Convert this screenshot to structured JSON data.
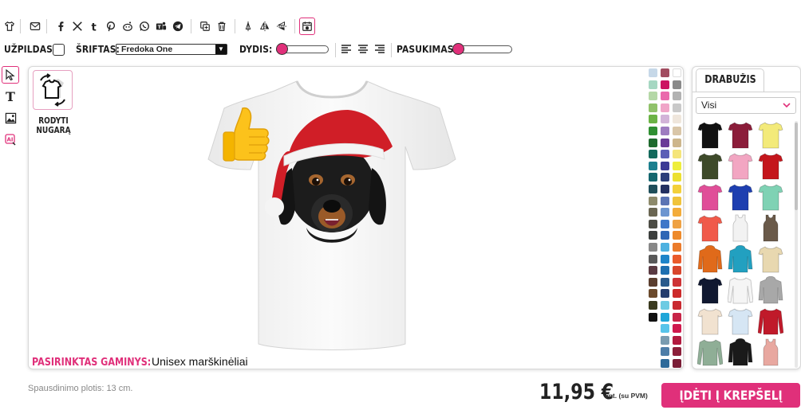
{
  "toolbar_text": {
    "fill_label": "UŽPILDAS:",
    "font_label": "ŠRIFTAS:",
    "font_value": "Fredoka One",
    "size_label": "DYDIS:",
    "size_value": 0,
    "rotation_label": "PASUKIMAS:",
    "rotation_value": 0
  },
  "canvas": {
    "show_back_label": "RODYTI NUGARĄ",
    "selected_product_label": "PASIRINKTAS GAMINYS:",
    "selected_product_value": "Unisex marškinėliai"
  },
  "palette": [
    "#c6d8e8",
    "#a14c60",
    "#ffffff",
    "#a6d7c2",
    "#cc1361",
    "#8a8a8a",
    "#b5d8a7",
    "#ea6aac",
    "#b2b2b2",
    "#90c26a",
    "#f0a5c8",
    "#c9c9c9",
    "#6bb345",
    "#d2b3d8",
    "#efe6dc",
    "#2f8f32",
    "#9e7cc0",
    "#d9c6a8",
    "#1e6a2e",
    "#6a3b97",
    "#cdb68c",
    "#146a5c",
    "#5b5fb6",
    "#f5e57a",
    "#1b7f8e",
    "#3b3a95",
    "#eeee3c",
    "#14666e",
    "#2c3e7a",
    "#ece030",
    "#1f4e5a",
    "#243061",
    "#f3d03a",
    "#8d8a6b",
    "#5b74b4",
    "#f0c33b",
    "#6a6652",
    "#6c95d0",
    "#f3ac3a",
    "#4d4d45",
    "#3f77c8",
    "#efa244",
    "#3c3f3d",
    "#2f67b5",
    "#ee8a2a",
    "#888888",
    "#4db1e0",
    "#eb7b2b",
    "#595959",
    "#1d84c9",
    "#ea5a2a",
    "#5a3a42",
    "#1d6fb0",
    "#d8452c",
    "#5b3e2e",
    "#295a8c",
    "#ce3336",
    "#6b4a2c",
    "#253d6e",
    "#cc2a2a",
    "#3a3a1e",
    "#6ccbe3",
    "#c92930",
    "#111111",
    "#1fa6d8",
    "#c82548",
    null,
    "#57c4ea",
    "#d0194d",
    null,
    "#7a9cb0",
    "#b21a3f",
    null,
    "#4e7ea8",
    "#8c1f3a",
    null,
    "#2e6a9a",
    "#7a1d36",
    null,
    "#6aa4c8",
    "#6a1c38",
    null,
    "#aee1f5",
    "#561a35"
  ],
  "garments_panel": {
    "tab_label": "DRABUŽIS",
    "filter_value": "Visi",
    "items": [
      {
        "name": "black-tshirt",
        "color": "#111111",
        "shape": "tee"
      },
      {
        "name": "burgundy-tshirt",
        "color": "#8b1d3a",
        "shape": "tee"
      },
      {
        "name": "yellow-tshirt",
        "color": "#f3ea7a",
        "shape": "tee"
      },
      {
        "name": "olive-tshirt",
        "color": "#3e4a2a",
        "shape": "tee"
      },
      {
        "name": "pink-tshirt",
        "color": "#f2a6c2",
        "shape": "tee"
      },
      {
        "name": "red-tshirt",
        "color": "#c4161c",
        "shape": "tee"
      },
      {
        "name": "fuchsia-tshirt",
        "color": "#e04e98",
        "shape": "tee"
      },
      {
        "name": "blue-tshirt",
        "color": "#1e3fb0",
        "shape": "tee"
      },
      {
        "name": "mint-tshirt",
        "color": "#7fd2b4",
        "shape": "tee"
      },
      {
        "name": "coral-tshirt",
        "color": "#f05a4a",
        "shape": "tee"
      },
      {
        "name": "white-tanktop",
        "color": "#f2f2f2",
        "shape": "tank"
      },
      {
        "name": "brown-tanktop",
        "color": "#6a5a4a",
        "shape": "tank"
      },
      {
        "name": "orange-hoodie",
        "color": "#e06a1a",
        "shape": "hoodie"
      },
      {
        "name": "teal-hoodie",
        "color": "#22a0c0",
        "shape": "hoodie"
      },
      {
        "name": "tiedye-tshirt",
        "color": "#e8d8b0",
        "shape": "tee"
      },
      {
        "name": "navy-tshirt",
        "color": "#101830",
        "shape": "tee"
      },
      {
        "name": "raglan-longsleeve",
        "color": "#f5f5f5",
        "shape": "long"
      },
      {
        "name": "grey-hoodie",
        "color": "#a8a8a8",
        "shape": "hoodie"
      },
      {
        "name": "cream-tshirt",
        "color": "#f1e2d0",
        "shape": "tee"
      },
      {
        "name": "lightblue-tshirt",
        "color": "#d6e6f4",
        "shape": "tee"
      },
      {
        "name": "red-jacket",
        "color": "#c01a2a",
        "shape": "long"
      },
      {
        "name": "sage-longsleeve",
        "color": "#8fae96",
        "shape": "long"
      },
      {
        "name": "black-orange-hoodie",
        "color": "#1a1a1a",
        "shape": "hoodie"
      },
      {
        "name": "rose-tanktop",
        "color": "#e8a8a0",
        "shape": "tank"
      }
    ]
  },
  "footer": {
    "print_width": "Spausdinimo plotis: 13 cm.",
    "price": "11,95 €",
    "vat_note": "vnt. (su PVM)",
    "cart_button": "ĮDĖTI Į KREPŠELĮ"
  }
}
